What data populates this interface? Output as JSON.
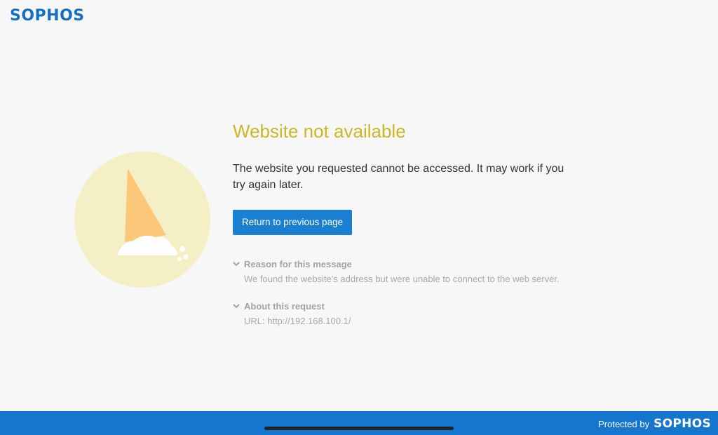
{
  "header": {
    "logo_text": "SOPHOS"
  },
  "main": {
    "title": "Website not available",
    "description": "The website you requested cannot be accessed. It may work if you try again later.",
    "return_button": "Return to previous page",
    "sections": [
      {
        "title": "Reason for this message",
        "body": "We found the website's address but were unable to connect to the web server."
      },
      {
        "title": "About this request",
        "body": "URL: http://192.168.100.1/"
      }
    ]
  },
  "footer": {
    "protected_by": "Protected by",
    "logo_text": "SOPHOS"
  },
  "colors": {
    "brand": "#1570c4",
    "title": "#c8b826",
    "button": "#1a7fd0",
    "footer": "#1476cf"
  },
  "icons": [
    "melted-ice-cream-cone-icon",
    "chevron-down-icon"
  ]
}
